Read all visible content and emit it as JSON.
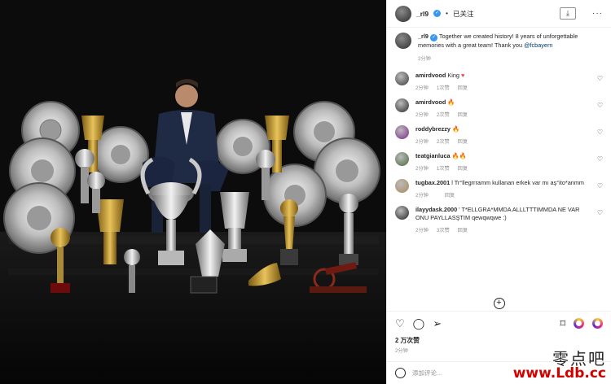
{
  "post": {
    "username": "_rl9",
    "follow_label": "已关注",
    "caption": "Together we created history! 8 years of unforgettable memories with a great team! Thank you ",
    "caption_mention": "@fcbayern",
    "caption_time": "2分钟",
    "likes": "2 万次赞",
    "posted_time": "2分钟",
    "add_comment_placeholder": "添加评论..."
  },
  "comments": [
    {
      "user": "amirdvood",
      "text": "King",
      "emoji": "♥",
      "time": "2分钟",
      "likes": "1次赞",
      "reply": "回复"
    },
    {
      "user": "amirdvood",
      "text": "",
      "emoji": "🔥",
      "time": "2分钟",
      "likes": "2次赞",
      "reply": "回复"
    },
    {
      "user": "roddybrezzy",
      "text": "",
      "emoji": "🔥",
      "time": "2分钟",
      "likes": "2次赞",
      "reply": "回复"
    },
    {
      "user": "teatgianluca",
      "text": "",
      "emoji": "🔥🔥",
      "time": "2分钟",
      "likes": "1次赞",
      "reply": "回复"
    },
    {
      "user": "tugbax.2001",
      "text": "l Tr°llegrrramm kullanan erkek var mı aş°ito*anmm",
      "emoji": "",
      "time": "2分钟",
      "likes": "",
      "reply": "回复"
    },
    {
      "user": "ilayydask.2000",
      "text": "' T*ELLGRA*MMDA ALLLTTTIMMDA NE VAR ONU PAYLLASŞTIM qewqwqwe :)",
      "emoji": "",
      "time": "2分钟",
      "likes": "3次赞",
      "reply": "回复"
    }
  ],
  "watermark": {
    "top": "零点吧",
    "bottom": "www.Ldb.cc"
  },
  "icons": {
    "download": "download-icon",
    "more": "more-icon",
    "like": "heart-icon",
    "comment": "comment-icon",
    "share": "share-icon",
    "save": "bookmark-icon",
    "emoji": "emoji-icon",
    "add": "plus-circle-icon"
  },
  "colors": {
    "verified": "#3897f0",
    "link": "#00376b",
    "muted": "#8e8e8e",
    "heart": "#ed4956"
  }
}
